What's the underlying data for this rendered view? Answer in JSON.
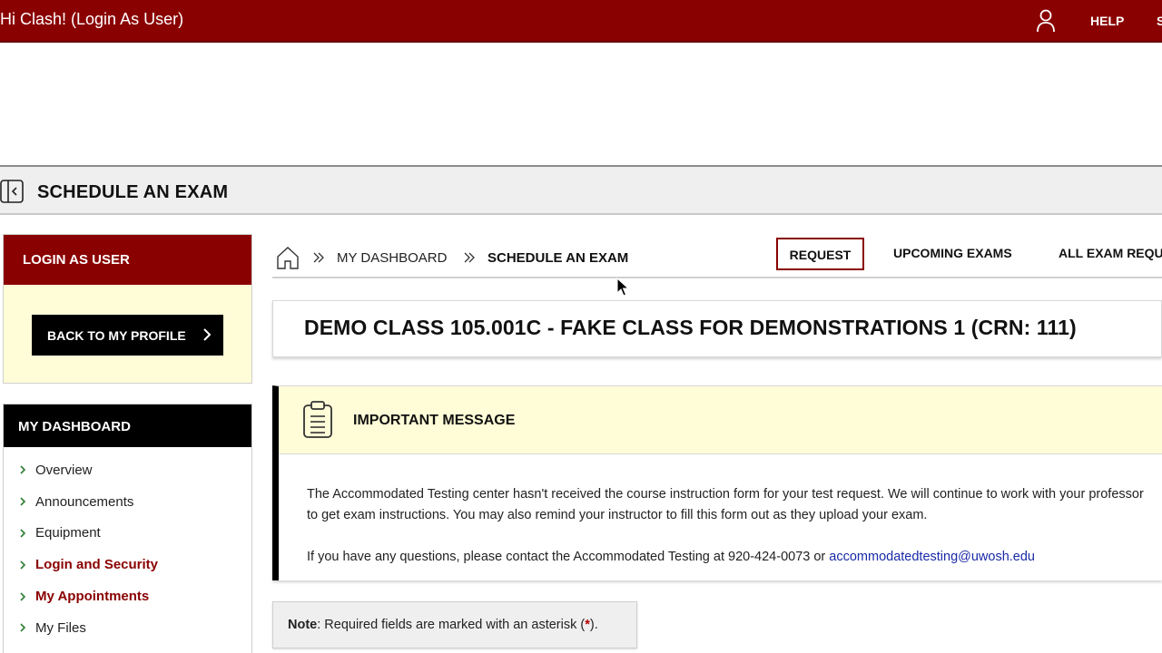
{
  "header": {
    "greeting": "Hi Clash! (Login As User)",
    "help_label": "HELP",
    "extra_label": "S"
  },
  "titlebar": {
    "title": "SCHEDULE AN EXAM"
  },
  "sidebar": {
    "login_panel": {
      "heading": "LOGIN AS USER",
      "back_button": "BACK TO MY PROFILE"
    },
    "dashboard_panel": {
      "heading": "MY DASHBOARD",
      "items": [
        {
          "label": "Overview"
        },
        {
          "label": "Announcements"
        },
        {
          "label": "Equipment"
        },
        {
          "label": "Login and Security"
        },
        {
          "label": "My Appointments"
        },
        {
          "label": "My Files"
        }
      ]
    }
  },
  "breadcrumb": {
    "dashboard": "MY DASHBOARD",
    "current": "SCHEDULE AN EXAM"
  },
  "tabs": {
    "request": "REQUEST",
    "upcoming": "UPCOMING EXAMS",
    "all_requests": "ALL EXAM REQU"
  },
  "class_card": {
    "name": "DEMO CLASS 105.001C - FAKE CLASS FOR DEMONSTRATIONS 1 (CRN: 111)"
  },
  "message": {
    "title": "IMPORTANT MESSAGE",
    "paragraph1": "The Accommodated Testing center hasn't received the course instruction form for your test request. We will continue to work with your professor to get exam instructions. You may also remind your instructor to fill this form out as they upload your exam.",
    "paragraph2_prefix": "If you have any questions, please contact the Accommodated Testing at 920-424-0073 or ",
    "email": "accommodatedtesting@uwosh.edu"
  },
  "note": {
    "label": "Note",
    "text": ": Required fields are marked with an asterisk (",
    "star": "*",
    "suffix": ")."
  },
  "colors": {
    "brand_maroon": "#8a0101",
    "highlight_yellow": "#fffdd7",
    "link_blue": "#1a2aa8"
  }
}
